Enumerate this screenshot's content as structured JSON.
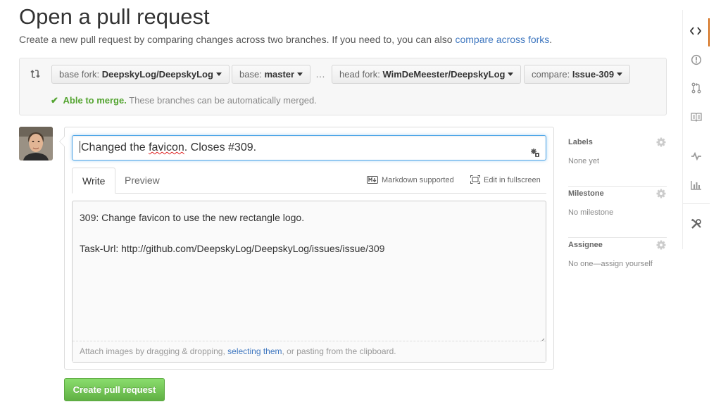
{
  "header": {
    "title": "Open a pull request",
    "subtitle_text": "Create a new pull request by comparing changes across two branches. If you need to, you can also ",
    "subtitle_link": "compare across forks",
    "subtitle_end": "."
  },
  "range": {
    "base_fork_label": "base fork:",
    "base_fork_value": "DeepskyLog/DeepskyLog",
    "base_label": "base:",
    "base_value": "master",
    "ellipsis": "…",
    "head_fork_label": "head fork:",
    "head_fork_value": "WimDeMeester/DeepskyLog",
    "compare_label": "compare:",
    "compare_value": "Issue-309",
    "merge_status": "Able to merge.",
    "merge_detail": "These branches can be automatically merged."
  },
  "form": {
    "title_pre": "Changed the ",
    "title_spell": "favicon",
    "title_post": ". Closes #309.",
    "tabs": [
      "Write",
      "Preview"
    ],
    "markdown_label": "Markdown supported",
    "fullscreen_label": "Edit in fullscreen",
    "body": "309: Change favicon to use the new rectangle logo.\n\nTask-Url: http://github.com/DeepskyLog/DeepskyLog/issues/issue/309",
    "drop_hint_pre": "Attach images by dragging & dropping, ",
    "drop_hint_link": "selecting them",
    "drop_hint_post": ", or pasting from the clipboard.",
    "submit_label": "Create pull request"
  },
  "sidebar": {
    "labels": {
      "heading": "Labels",
      "value": "None yet"
    },
    "milestone": {
      "heading": "Milestone",
      "value": "No milestone"
    },
    "assignee": {
      "heading": "Assignee",
      "value": "No one—assign yourself"
    }
  },
  "repo_nav": {
    "items": [
      "code-icon",
      "issues-icon",
      "pull-requests-icon",
      "wiki-icon",
      "pulse-icon",
      "graphs-icon",
      "settings-icon"
    ],
    "selected": "code-icon",
    "accent_color": "#d26911"
  },
  "colors": {
    "link": "#4078c0",
    "success": "#55a532",
    "focus": "#51a7e8",
    "submit": "#60b044"
  }
}
